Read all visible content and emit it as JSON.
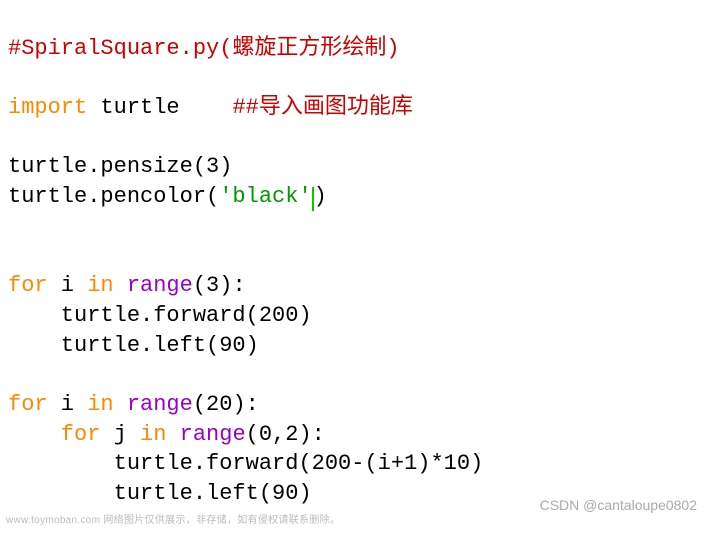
{
  "code": {
    "line1_comment": "#SpiralSquare.py(螺旋正方形绘制)",
    "line3_import": "import",
    "line3_turtle": " turtle    ",
    "line3_comment": "##导入画图功能库",
    "line5": "turtle.pensize(3)",
    "line6_a": "turtle.pencolor(",
    "line6_str": "'black'",
    "line6_b": ")",
    "line9_for": "for",
    "line9_i": " i ",
    "line9_in": "in",
    "line9_sp": " ",
    "line9_range": "range",
    "line9_args": "(3):",
    "line10": "    turtle.forward(200)",
    "line11": "    turtle.left(90)",
    "line13_for": "for",
    "line13_i": " i ",
    "line13_in": "in",
    "line13_sp": " ",
    "line13_range": "range",
    "line13_args": "(20):",
    "line14_for": "    for",
    "line14_j": " j ",
    "line14_in": "in",
    "line14_sp": " ",
    "line14_range": "range",
    "line14_args": "(0,2):",
    "line15": "        turtle.forward(200-(i+1)*10)",
    "line16": "        turtle.left(90)"
  },
  "watermark": {
    "left": "www.toymoban.com 网络图片仅供展示，非存储，如有侵权请联系删除。",
    "right": "CSDN @cantaloupe0802"
  }
}
